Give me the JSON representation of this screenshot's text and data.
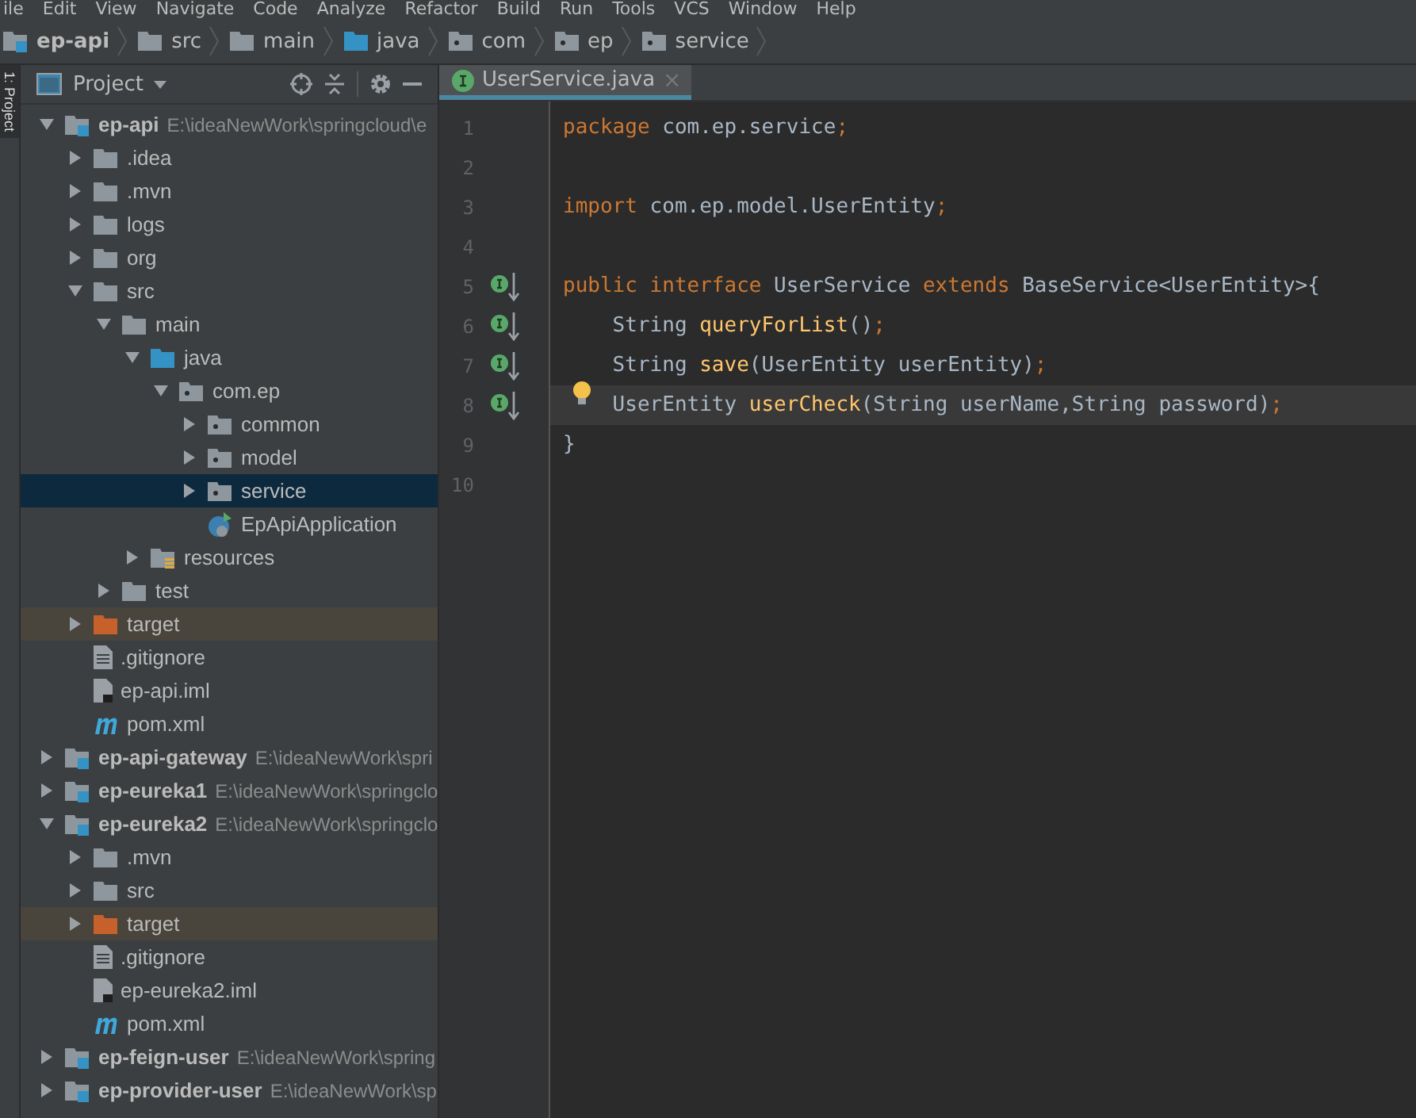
{
  "menu_bar": [
    "ile",
    "Edit",
    "View",
    "Navigate",
    "Code",
    "Analyze",
    "Refactor",
    "Build",
    "Run",
    "Tools",
    "VCS",
    "Window",
    "Help"
  ],
  "breadcrumbs": [
    {
      "label": "ep-api",
      "kind": "module"
    },
    {
      "label": "src",
      "kind": "folder"
    },
    {
      "label": "main",
      "kind": "folder"
    },
    {
      "label": "java",
      "kind": "source-root"
    },
    {
      "label": "com",
      "kind": "package"
    },
    {
      "label": "ep",
      "kind": "package"
    },
    {
      "label": "service",
      "kind": "package"
    }
  ],
  "side_tab": "1: Project",
  "project_panel": {
    "title": "Project",
    "tree": [
      {
        "label": "ep-api",
        "path": "E:\\ideaNewWork\\springcloud\\e",
        "kind": "module",
        "expanded": true,
        "selected": false,
        "children": [
          {
            "label": ".idea",
            "kind": "folder",
            "expanded": false,
            "selected": false
          },
          {
            "label": ".mvn",
            "kind": "folder",
            "expanded": false,
            "selected": false
          },
          {
            "label": "logs",
            "kind": "folder",
            "expanded": false,
            "selected": false
          },
          {
            "label": "org",
            "kind": "folder",
            "expanded": false,
            "selected": false
          },
          {
            "label": "src",
            "kind": "folder",
            "expanded": true,
            "selected": false,
            "children": [
              {
                "label": "main",
                "kind": "folder",
                "expanded": true,
                "selected": false,
                "children": [
                  {
                    "label": "java",
                    "kind": "source-root",
                    "expanded": true,
                    "selected": false,
                    "children": [
                      {
                        "label": "com.ep",
                        "kind": "package",
                        "expanded": true,
                        "selected": false,
                        "children": [
                          {
                            "label": "common",
                            "kind": "package",
                            "expanded": false,
                            "selected": false
                          },
                          {
                            "label": "model",
                            "kind": "package",
                            "expanded": false,
                            "selected": false
                          },
                          {
                            "label": "service",
                            "kind": "package",
                            "expanded": false,
                            "selected": true
                          },
                          {
                            "label": "EpApiApplication",
                            "kind": "class",
                            "selected": false
                          }
                        ]
                      }
                    ]
                  },
                  {
                    "label": "resources",
                    "kind": "resources",
                    "expanded": false,
                    "selected": false
                  }
                ]
              },
              {
                "label": "test",
                "kind": "folder",
                "expanded": false,
                "selected": false
              }
            ]
          },
          {
            "label": "target",
            "kind": "excluded-folder",
            "expanded": false,
            "selected": false
          },
          {
            "label": ".gitignore",
            "kind": "text-file",
            "selected": false
          },
          {
            "label": "ep-api.iml",
            "kind": "iml-file",
            "selected": false
          },
          {
            "label": "pom.xml",
            "kind": "maven-file",
            "selected": false
          }
        ]
      },
      {
        "label": "ep-api-gateway",
        "path": "E:\\ideaNewWork\\spri",
        "kind": "module",
        "expanded": false,
        "selected": false
      },
      {
        "label": "ep-eureka1",
        "path": "E:\\ideaNewWork\\springclo",
        "kind": "module",
        "expanded": false,
        "selected": false
      },
      {
        "label": "ep-eureka2",
        "path": "E:\\ideaNewWork\\springclo",
        "kind": "module",
        "expanded": true,
        "selected": false,
        "children": [
          {
            "label": ".mvn",
            "kind": "folder",
            "expanded": false,
            "selected": false
          },
          {
            "label": "src",
            "kind": "folder",
            "expanded": false,
            "selected": false
          },
          {
            "label": "target",
            "kind": "excluded-folder",
            "expanded": false,
            "selected": false
          },
          {
            "label": ".gitignore",
            "kind": "text-file",
            "selected": false
          },
          {
            "label": "ep-eureka2.iml",
            "kind": "iml-file",
            "selected": false
          },
          {
            "label": "pom.xml",
            "kind": "maven-file",
            "selected": false
          }
        ]
      },
      {
        "label": "ep-feign-user",
        "path": "E:\\ideaNewWork\\spring",
        "kind": "module",
        "expanded": false,
        "selected": false
      },
      {
        "label": "ep-provider-user",
        "path": "E:\\ideaNewWork\\sp",
        "kind": "module",
        "expanded": false,
        "selected": false
      }
    ]
  },
  "editor": {
    "tabs": [
      {
        "label": "UserService.java",
        "close": "×",
        "selected": true
      }
    ],
    "lines": [
      {
        "number": "1",
        "implements": false,
        "bulb": false,
        "current": false,
        "tokens": [
          {
            "text": "package",
            "kind": "keyword"
          },
          {
            "text": " com.ep.service",
            "kind": "plain"
          },
          {
            "text": ";",
            "kind": "keyword"
          }
        ]
      },
      {
        "number": "2",
        "implements": false,
        "bulb": false,
        "current": false
      },
      {
        "number": "3",
        "implements": false,
        "bulb": false,
        "current": false,
        "tokens": [
          {
            "text": "import",
            "kind": "keyword"
          },
          {
            "text": " com.ep.model.UserEntity",
            "kind": "plain"
          },
          {
            "text": ";",
            "kind": "keyword"
          }
        ]
      },
      {
        "number": "4",
        "implements": false,
        "bulb": false,
        "current": false
      },
      {
        "number": "5",
        "implements": true,
        "bulb": false,
        "current": false,
        "tokens": [
          {
            "text": "public interface",
            "kind": "keyword"
          },
          {
            "text": " UserService ",
            "kind": "plain"
          },
          {
            "text": "extends",
            "kind": "keyword"
          },
          {
            "text": " BaseService<UserEntity>{",
            "kind": "plain"
          }
        ]
      },
      {
        "number": "6",
        "implements": true,
        "bulb": false,
        "current": false,
        "tokens": [
          {
            "text": "    String ",
            "kind": "plain"
          },
          {
            "text": "queryForList",
            "kind": "method"
          },
          {
            "text": "()",
            "kind": "plain"
          },
          {
            "text": ";",
            "kind": "keyword"
          }
        ]
      },
      {
        "number": "7",
        "implements": true,
        "bulb": false,
        "current": false,
        "tokens": [
          {
            "text": "    String ",
            "kind": "plain"
          },
          {
            "text": "save",
            "kind": "method"
          },
          {
            "text": "(UserEntity userEntity)",
            "kind": "plain"
          },
          {
            "text": ";",
            "kind": "keyword"
          }
        ]
      },
      {
        "number": "8",
        "implements": true,
        "bulb": true,
        "current": true,
        "tokens": [
          {
            "text": "    UserEntity ",
            "kind": "plain"
          },
          {
            "text": "userCheck",
            "kind": "method"
          },
          {
            "text": "(String userName,String password)",
            "kind": "plain"
          },
          {
            "text": ";",
            "kind": "keyword"
          }
        ]
      },
      {
        "number": "9",
        "implements": false,
        "bulb": false,
        "current": false,
        "tokens": [
          {
            "text": "}",
            "kind": "plain"
          }
        ]
      },
      {
        "number": "10",
        "implements": false,
        "bulb": false,
        "current": false
      }
    ]
  }
}
